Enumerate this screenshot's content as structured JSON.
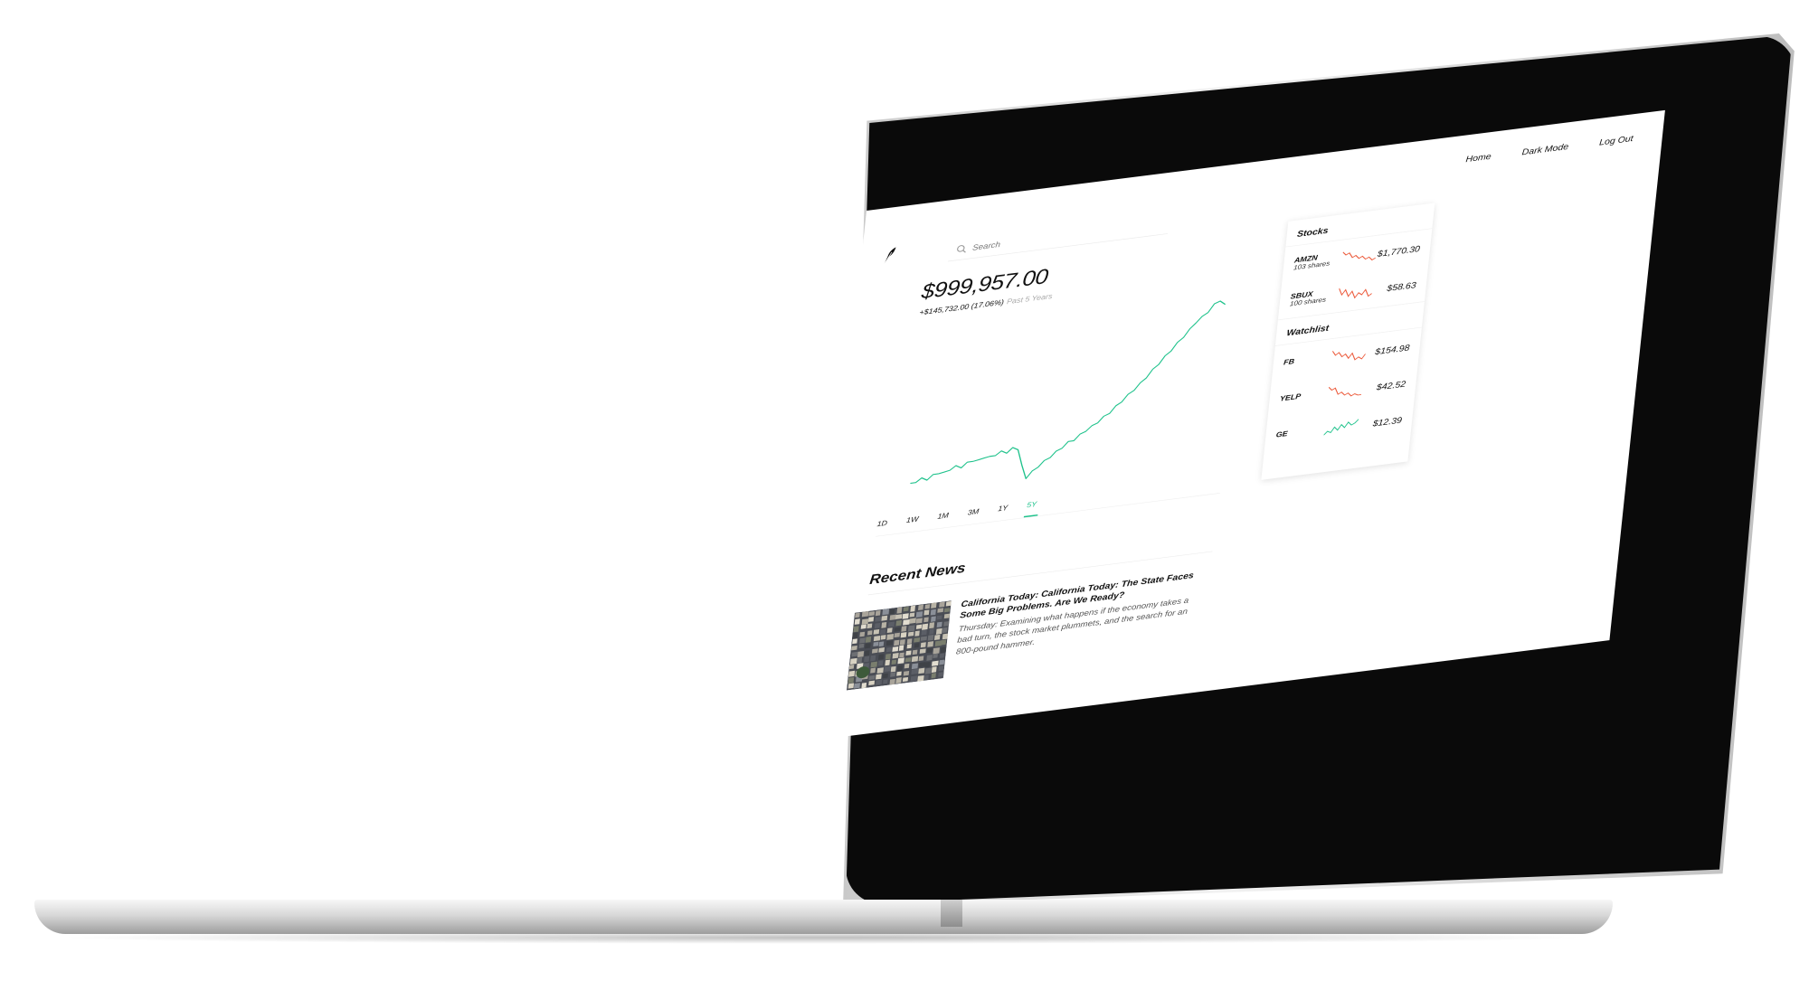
{
  "nav": {
    "home": "Home",
    "dark_mode": "Dark Mode",
    "logout": "Log Out"
  },
  "search": {
    "placeholder": "Search"
  },
  "portfolio": {
    "balance": "$999,957.00",
    "change": "+$145,732.00 (17.06%)",
    "period": "Past 5 Years"
  },
  "range_tabs": [
    "1D",
    "1W",
    "1M",
    "3M",
    "1Y",
    "5Y"
  ],
  "range_active": "5Y",
  "colors": {
    "up": "#1ec28b",
    "down": "#ec5b3c",
    "text": "#111111"
  },
  "chart_data": {
    "type": "line",
    "title": "",
    "xlabel": "",
    "ylabel": "",
    "series": [
      {
        "values": [
          854,
          856,
          858,
          857,
          860,
          862,
          861,
          864,
          866,
          865,
          868,
          870,
          869,
          872,
          871,
          873,
          875,
          874,
          877,
          876,
          858,
          846,
          851,
          856,
          860,
          864,
          868,
          872,
          876,
          878,
          882,
          886,
          889,
          893,
          897,
          901,
          906,
          911,
          916,
          921,
          926,
          932,
          938,
          944,
          950,
          956,
          962,
          968,
          974,
          981,
          985,
          990,
          996,
          1000,
          994
        ]
      }
    ]
  },
  "news": {
    "heading": "Recent News",
    "items": [
      {
        "title": "California Today: California Today: The State Faces Some Big Problems. Are We Ready?",
        "description": "Thursday: Examining what happens if the economy takes a bad turn, the stock market plummets, and the search for an 800-pound hammer.",
        "thumbnail": "aerial-city-houses"
      }
    ]
  },
  "stocks": {
    "heading": "Stocks",
    "items": [
      {
        "ticker": "AMZN",
        "shares": "103 shares",
        "price": "$1,770.30",
        "trend": "down",
        "spark": [
          9,
          7,
          8,
          5,
          6,
          4,
          5,
          3,
          4,
          2,
          3
        ]
      },
      {
        "ticker": "SBUX",
        "shares": "100 shares",
        "price": "$58.63",
        "trend": "down",
        "spark": [
          8,
          5,
          7,
          4,
          6,
          3,
          5,
          4,
          6,
          3,
          4
        ]
      }
    ]
  },
  "watchlist": {
    "heading": "Watchlist",
    "items": [
      {
        "ticker": "FB",
        "price": "$154.98",
        "trend": "down",
        "spark": [
          8,
          6,
          7,
          5,
          6,
          4,
          6,
          3,
          4,
          3,
          5
        ]
      },
      {
        "ticker": "YELP",
        "price": "$42.52",
        "trend": "down",
        "spark": [
          9,
          7,
          8,
          4,
          5,
          3,
          4,
          2,
          3,
          2,
          2
        ]
      },
      {
        "ticker": "GE",
        "price": "$12.39",
        "trend": "up",
        "spark": [
          2,
          4,
          3,
          6,
          4,
          7,
          5,
          8,
          6,
          7,
          9
        ]
      }
    ]
  }
}
